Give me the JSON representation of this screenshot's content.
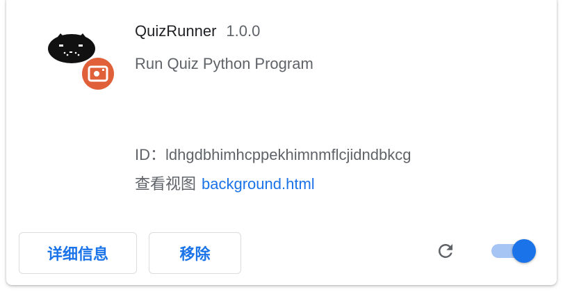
{
  "extension": {
    "name": "QuizRunner",
    "version": "1.0.0",
    "description": "Run Quiz Python Program",
    "id_label": "ID：",
    "id_value": "ldhgdbhimhcppekhimnmflcjidndbkcg",
    "views_label": "查看视图",
    "views_link": "background.html",
    "icon": "cat-face-icon",
    "badge_icon": "camera-badge-icon"
  },
  "actions": {
    "details_label": "详细信息",
    "remove_label": "移除",
    "reload_icon": "reload-icon",
    "enabled": true
  },
  "colors": {
    "accent": "#1a73e8",
    "badge": "#e0603a",
    "text_primary": "#202124",
    "text_secondary": "#5f6368"
  }
}
